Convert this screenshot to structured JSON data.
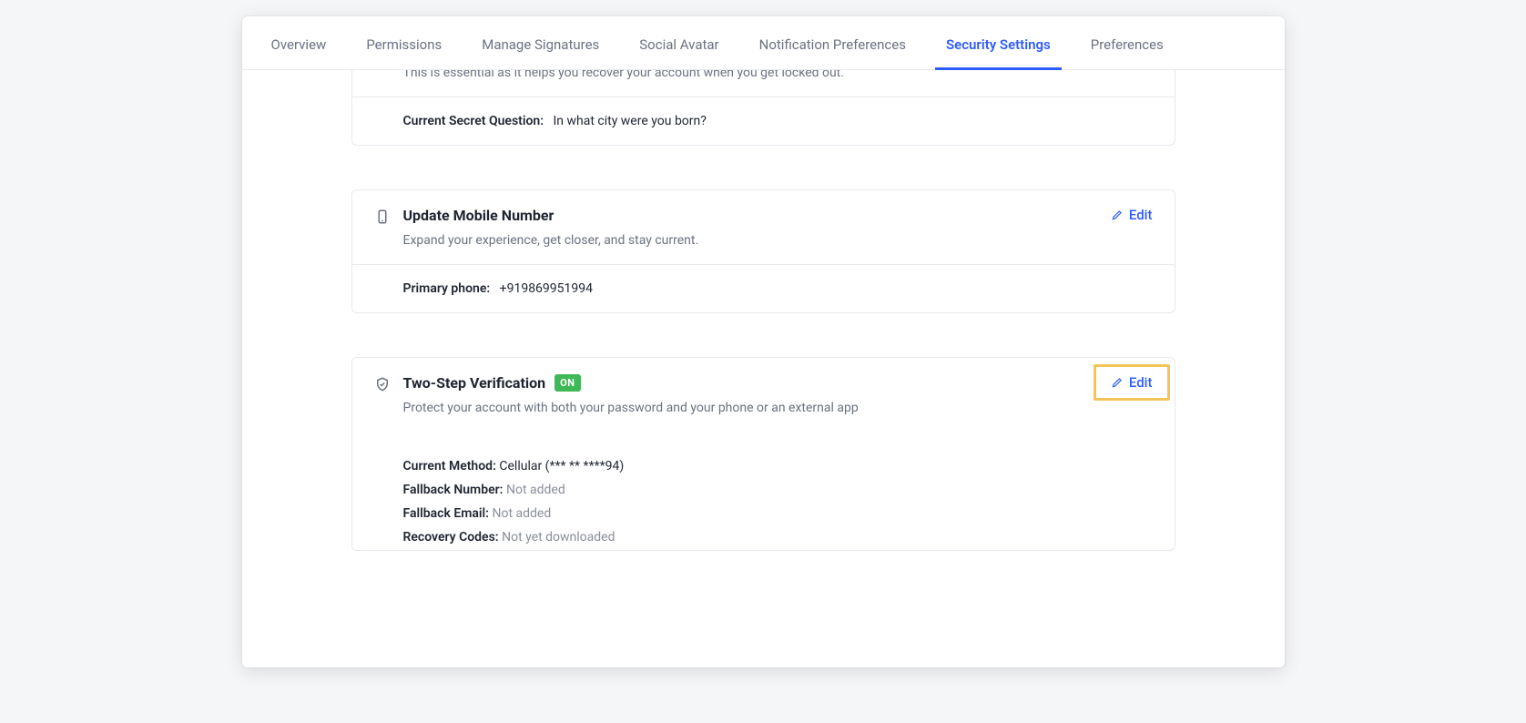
{
  "tabs": [
    {
      "label": "Overview"
    },
    {
      "label": "Permissions"
    },
    {
      "label": "Manage Signatures"
    },
    {
      "label": "Social Avatar"
    },
    {
      "label": "Notification Preferences"
    },
    {
      "label": "Security Settings"
    },
    {
      "label": "Preferences"
    }
  ],
  "edit_label": "Edit",
  "secret_question": {
    "description": "This is essential as it helps you recover your account when you get locked out.",
    "label": "Current Secret Question:",
    "value": "In what city were you born?"
  },
  "mobile": {
    "title": "Update Mobile Number",
    "description": "Expand your experience, get closer, and stay current.",
    "label": "Primary phone:",
    "value": "+919869951994"
  },
  "tsv": {
    "title": "Two-Step Verification",
    "badge": "ON",
    "description": "Protect your account with both your password and your phone or an external app",
    "current_method_label": "Current Method",
    "current_method_value": "Cellular (*** ** ****94)",
    "fallback_number_label": "Fallback Number",
    "fallback_number_value": "Not added",
    "fallback_email_label": "Fallback Email",
    "fallback_email_value": "Not added",
    "recovery_codes_label": "Recovery Codes",
    "recovery_codes_value": "Not yet downloaded"
  }
}
